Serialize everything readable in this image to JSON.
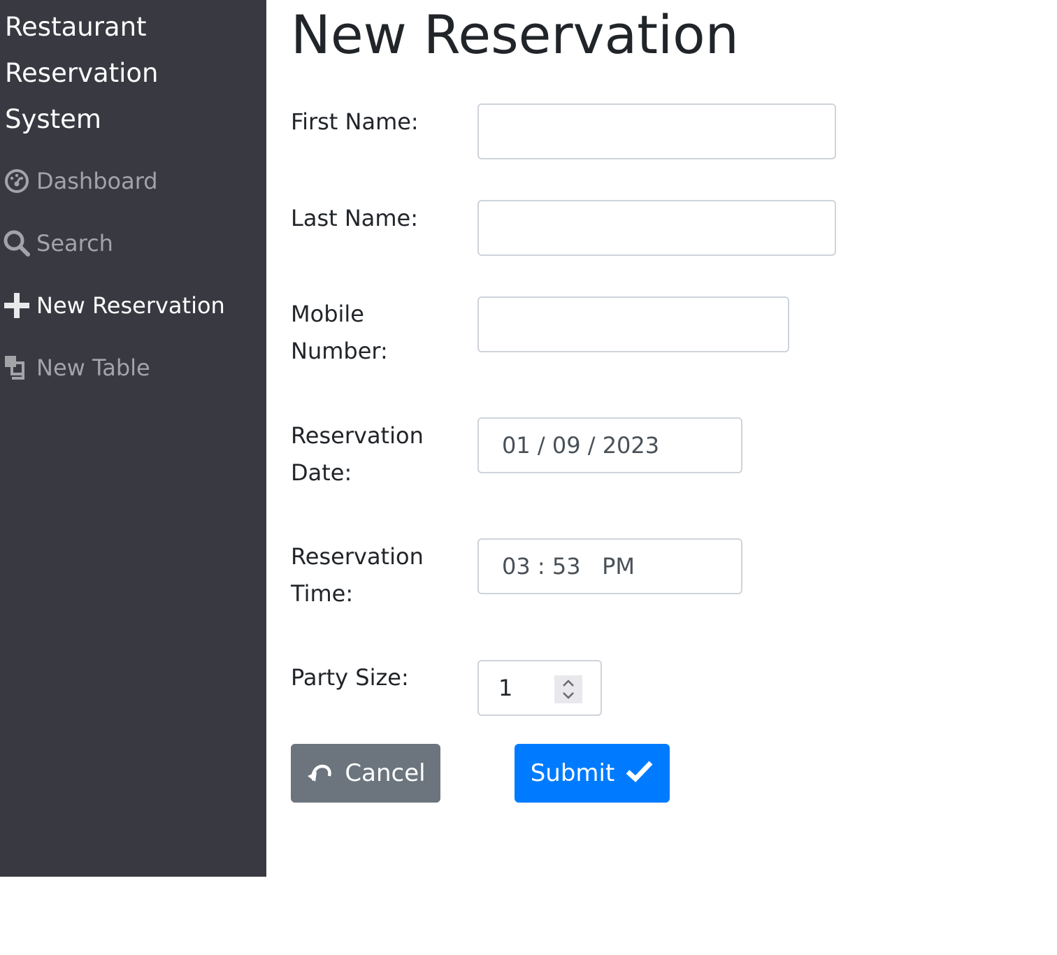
{
  "sidebar": {
    "title": "Restaurant Reservation System",
    "items": [
      {
        "label": "Dashboard",
        "icon": "dashboard-icon"
      },
      {
        "label": "Search",
        "icon": "search-icon"
      },
      {
        "label": "New Reservation",
        "icon": "plus-icon"
      },
      {
        "label": "New Table",
        "icon": "table-icon"
      }
    ]
  },
  "page": {
    "title": "New Reservation"
  },
  "form": {
    "first_name": {
      "label": "First Name:",
      "value": ""
    },
    "last_name": {
      "label": "Last Name:",
      "value": ""
    },
    "mobile_number": {
      "label": "Mobile Number:",
      "value": ""
    },
    "reservation_date": {
      "label": "Reservation Date:",
      "value": "01 / 09 / 2023"
    },
    "reservation_time": {
      "label": "Reservation Time:",
      "value": "03 : 53   PM"
    },
    "party_size": {
      "label": "Party Size:",
      "value": "1"
    }
  },
  "buttons": {
    "cancel": {
      "label": "Cancel",
      "icon": "undo-icon",
      "color": "#6c757d"
    },
    "submit": {
      "label": "Submit",
      "icon": "checkmark-icon",
      "color": "#007bff"
    }
  },
  "colors": {
    "sidebar_bg": "#393942",
    "nav_text": "#a3a4a8",
    "nav_active_text": "#ffffff"
  }
}
